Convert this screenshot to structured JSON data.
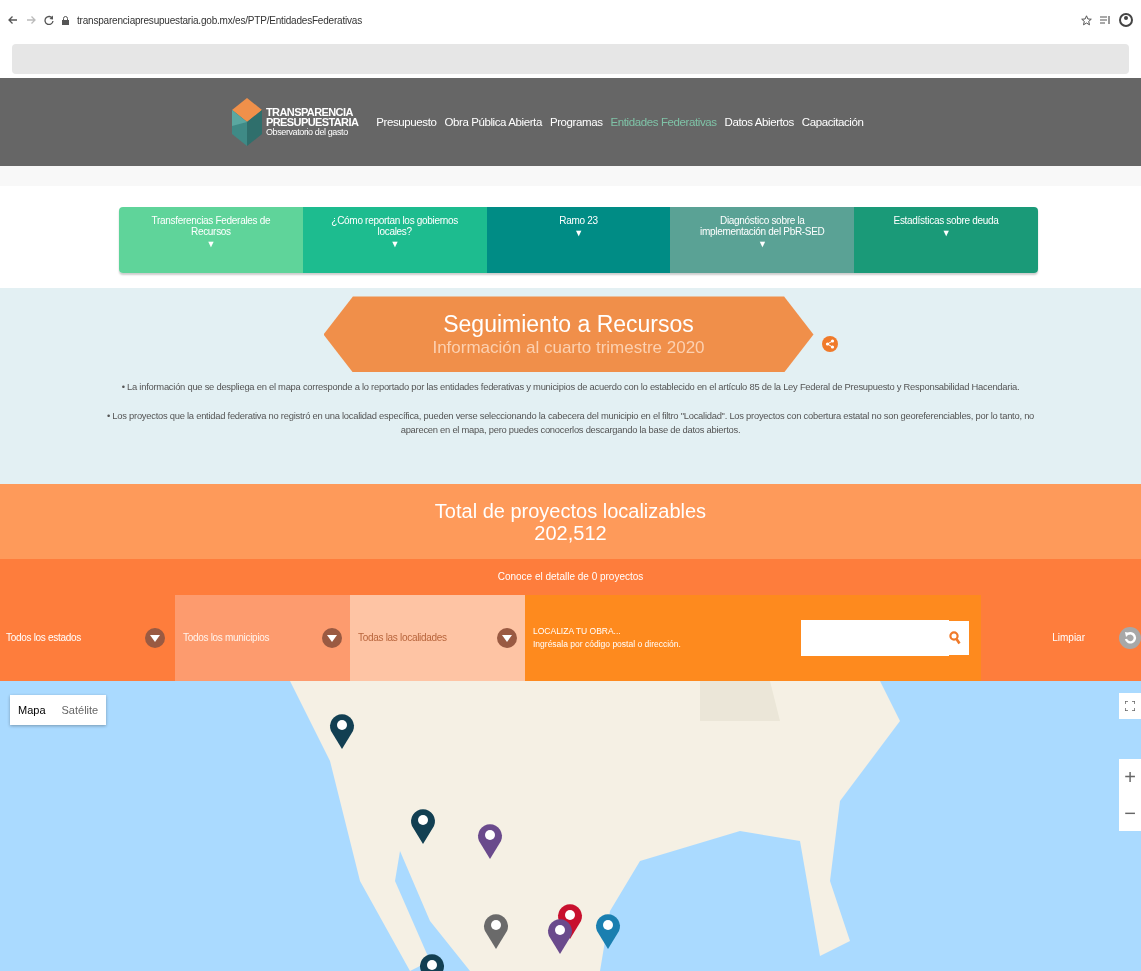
{
  "browser": {
    "url": "transparenciapresupuestaria.gob.mx/es/PTP/EntidadesFederativas"
  },
  "logo": {
    "lines": [
      "TRANSPARENCIA",
      "PRESUPUESTARIA",
      "Observatorio del gasto"
    ]
  },
  "nav": [
    {
      "label": "Presupuesto",
      "selected": false
    },
    {
      "label": "Obra Pública Abierta",
      "selected": false
    },
    {
      "label": "Programas",
      "selected": false
    },
    {
      "label": "Entidades Federativas",
      "selected": true
    },
    {
      "label": "Datos Abiertos",
      "selected": false
    },
    {
      "label": "Capacitación",
      "selected": false
    }
  ],
  "tabs": [
    {
      "label": "Transferencias Federales de Recursos",
      "color": "#5fd49a",
      "arrow": "▼"
    },
    {
      "label": "¿Cómo reportan los gobiernos locales?",
      "color": "#1dbc8f",
      "arrow": "▼"
    },
    {
      "label": "Ramo 23",
      "color": "#008c85",
      "arrow": "▼"
    },
    {
      "label": "Diagnóstico sobre la implementación del PbR-SED",
      "color": "#5aa295",
      "arrow": "▼"
    },
    {
      "label": "Estadísticas sobre deuda",
      "color": "#1a9a78",
      "arrow": "▼"
    }
  ],
  "banner": {
    "title": "Seguimiento a Recursos",
    "subtitle": "Información al cuarto trimestre 2020"
  },
  "notes": [
    "• La información que se despliega en el mapa corresponde a lo reportado por las entidades federativas y municipios de acuerdo con lo establecido en el artículo 85 de la Ley Federal de Presupuesto y Responsabilidad Hacendaria.",
    "• Los proyectos que la entidad federativa no registró en una localidad específica, pueden verse seleccionando la cabecera del municipio en el filtro \"Localidad\". Los proyectos con cobertura estatal no son georeferenciables, por lo tanto, no aparecen en el mapa, pero puedes conocerlos descargando la base de datos abiertos."
  ],
  "total": {
    "label": "Total de proyectos localizables",
    "value": "202,512",
    "detail": "Conoce el detalle de 0 proyectos"
  },
  "filters": [
    {
      "label": "Todos los estados",
      "color": "#fe7d3c"
    },
    {
      "label": "Todos los municipios",
      "color": "#fd9b6e"
    },
    {
      "label": "Todas las localidades",
      "color": "#fec4a4"
    }
  ],
  "locate": {
    "title": "LOCALIZA TU OBRA...",
    "hint": "Ingrésala por código postal o dirección."
  },
  "clear_button": "Limpiar",
  "map": {
    "types": [
      {
        "label": "Mapa",
        "selected": true
      },
      {
        "label": "Satélite",
        "selected": false
      }
    ],
    "zoom_in": "+",
    "zoom_out": "−"
  }
}
